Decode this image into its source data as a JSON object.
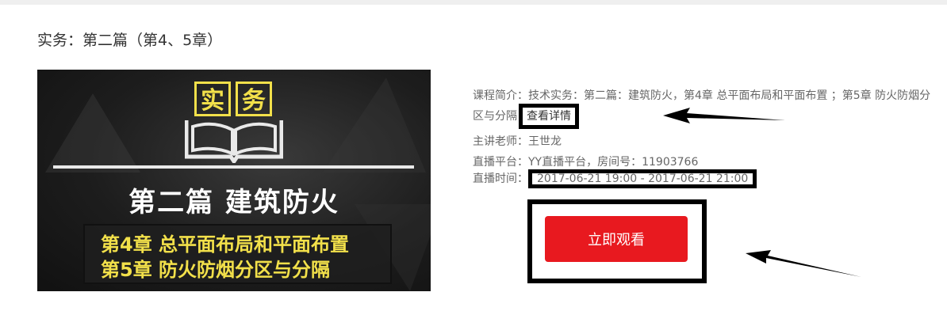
{
  "course": {
    "title": "实务：第二篇（第4、5章）",
    "banner": {
      "badge_chars": [
        "实",
        "务"
      ],
      "heading": "第二篇  建筑防火",
      "lines": [
        "第4章  总平面布局和平面布置",
        "第5章  防火防烟分区与分隔"
      ]
    },
    "intro_label": "课程简介：",
    "intro_text": "技术实务：第二篇：建筑防火，第4章 总平面布局和平面布置 ；第5章 防火防烟分区与分隔",
    "detail_link": "查看详情",
    "teacher_label": "主讲老师：",
    "teacher": "王世龙",
    "platform_label": "直播平台：",
    "platform": "YY直播平台，房间号：11903766",
    "time_label": "直播时间：",
    "time": "2017-06-21 19:00 - 2017-06-21 21:00",
    "watch_button": "立即观看"
  },
  "colors": {
    "accent": "#e8191f",
    "banner_yellow": "#f2e04a",
    "annotation": "#000000"
  }
}
